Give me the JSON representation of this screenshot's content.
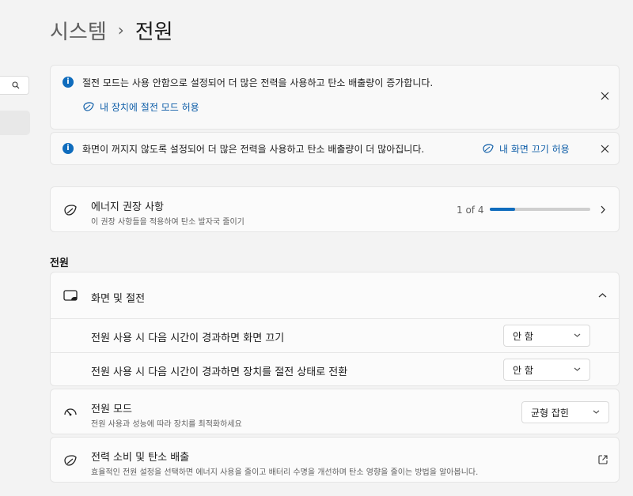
{
  "breadcrumb": {
    "parent": "시스템",
    "separator": "›",
    "current": "전원"
  },
  "notices": [
    {
      "message": "절전 모드는 사용 안함으로 설정되어 더 많은 전력을 사용하고 탄소 배출량이 증가합니다.",
      "action": "내 장치에 절전 모드 허용"
    },
    {
      "message": "화면이 꺼지지 않도록 설정되어 더 많은 전력을 사용하고 탄소 배출량이 더 많아집니다.",
      "action": "내 화면 끄기 허용"
    }
  ],
  "energy_recommendations": {
    "title": "에너지 권장 사항",
    "subtitle": "이 권장 사항들을 적용하여 탄소 발자국 줄이기",
    "progress_label": "1 of 4",
    "progress_fraction": 0.25
  },
  "section_title": "전원",
  "screen_sleep": {
    "title": "화면 및 절전",
    "rows": [
      {
        "label": "전원 사용 시 다음 시간이 경과하면 화면 끄기",
        "value": "안 함"
      },
      {
        "label": "전원 사용 시 다음 시간이 경과하면 장치를 절전 상태로 전환",
        "value": "안 함"
      }
    ]
  },
  "power_mode": {
    "title": "전원 모드",
    "subtitle": "전원 사용과 성능에 따라 장치를 최적화하세요",
    "value": "균형 잡힌"
  },
  "power_consumption": {
    "title": "전력 소비 및 탄소 배출",
    "subtitle": "효율적인 전원 설정을 선택하면 에너지 사용을 줄이고 배터리 수명을 개선하며 탄소 영향을 줄이는 방법을 알아봅니다."
  },
  "colors": {
    "accent": "#0f6cbd",
    "link": "#0f5ea8",
    "background": "#f3f3f3",
    "card": "#fbfbfb"
  }
}
